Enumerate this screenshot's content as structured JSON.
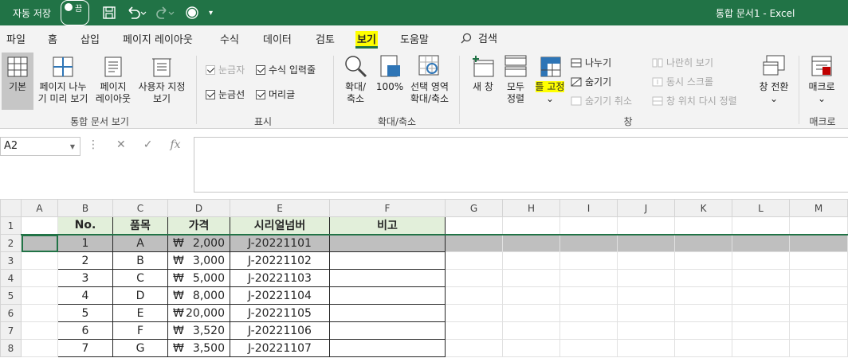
{
  "titlebar": {
    "autosave_label": "자동 저장",
    "autosave_state": "끔",
    "doc_title": "통합 문서1  -  Excel"
  },
  "tabs": [
    "파일",
    "홈",
    "삽입",
    "페이지 레이아웃",
    "수식",
    "데이터",
    "검토",
    "보기",
    "도움말"
  ],
  "active_tab": "보기",
  "search_label": "검색",
  "ribbon": {
    "workbook_views": {
      "label": "통합 문서 보기",
      "buttons": [
        {
          "line1": "기본",
          "line2": ""
        },
        {
          "line1": "페이지 나누",
          "line2": "기 미리 보기"
        },
        {
          "line1": "페이지",
          "line2": "레이아웃"
        },
        {
          "line1": "사용자 지정",
          "line2": "보기"
        }
      ]
    },
    "show": {
      "label": "표시",
      "ruler": "눈금자",
      "formula_bar": "수식 입력줄",
      "gridlines": "눈금선",
      "headings": "머리글"
    },
    "zoom": {
      "label": "확대/축소",
      "zoom_line1": "확대/",
      "zoom_line2": "축소",
      "hundred": "100%",
      "hundred_icon": "100",
      "sel_line1": "선택 영역",
      "sel_line2": "확대/축소"
    },
    "window": {
      "label": "창",
      "new_window": "새 창",
      "arrange_line1": "모두",
      "arrange_line2": "정렬",
      "freeze_panes": "틀 고정",
      "split": "나누기",
      "hide": "숨기기",
      "unhide": "숨기기 취소",
      "side_by_side": "나란히 보기",
      "sync_scroll": "동시 스크롤",
      "reset_pos": "창 위치 다시 정렬",
      "switch_windows": "창 전환"
    },
    "macros": {
      "label": "매크로",
      "button": "매크로"
    }
  },
  "namebox": "A2",
  "columns": [
    "A",
    "B",
    "C",
    "D",
    "E",
    "F",
    "G",
    "H",
    "I",
    "J",
    "K",
    "L",
    "M"
  ],
  "header_row": {
    "no": "No.",
    "item": "품목",
    "price": "가격",
    "serial": "시리얼넘버",
    "note": "비고"
  },
  "currency": "₩",
  "rows": [
    {
      "n": "1",
      "no": "1",
      "item": "A",
      "price": "2,000",
      "serial": "J-20221101"
    },
    {
      "n": "2",
      "no": "2",
      "item": "B",
      "price": "3,000",
      "serial": "J-20221102"
    },
    {
      "n": "3",
      "no": "3",
      "item": "C",
      "price": "5,000",
      "serial": "J-20221103"
    },
    {
      "n": "4",
      "no": "4",
      "item": "D",
      "price": "8,000",
      "serial": "J-20221104"
    },
    {
      "n": "5",
      "no": "5",
      "item": "E",
      "price": "20,000",
      "serial": "J-20221105"
    },
    {
      "n": "6",
      "no": "6",
      "item": "F",
      "price": "3,520",
      "serial": "J-20221106"
    },
    {
      "n": "7",
      "no": "7",
      "item": "G",
      "price": "3,500",
      "serial": "J-20221107"
    }
  ],
  "row_numbers": [
    "1",
    "2",
    "3",
    "4",
    "5",
    "6",
    "7",
    "8"
  ],
  "colors": {
    "excel_green": "#217346",
    "highlight": "#ffff00",
    "header_fill": "#e2efda",
    "selected_row": "#bfbfbf"
  }
}
